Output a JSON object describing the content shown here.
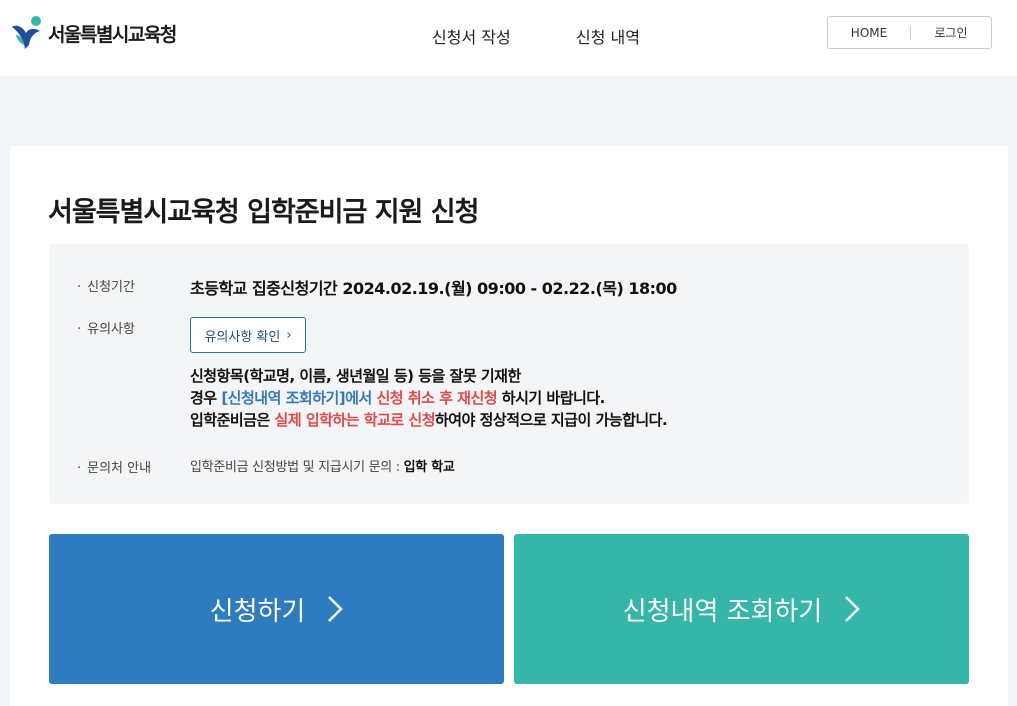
{
  "header": {
    "brand": "서울특별시교육청",
    "nav": [
      "신청서 작성",
      "신청 내역"
    ],
    "home_label": "HOME",
    "login_label": "로그인"
  },
  "page": {
    "title": "서울특별시교육청 입학준비금 지원 신청"
  },
  "info": {
    "period_label": "신청기간",
    "period_value": "초등학교 집중신청기간 2024.02.19.(월) 09:00 - 02.22.(목) 18:00",
    "notice_label": "유의사항",
    "notice_button": "유의사항 확인",
    "notice_line1": "신청항목(학교명, 이름, 생년월일 등) 등을 잘못 기재한",
    "notice_line2_a": "경우 ",
    "notice_line2_b": "[신청내역 조회하기]에서",
    "notice_line2_c": " ",
    "notice_line2_d": "신청 취소 후 재신청",
    "notice_line2_e": " 하시기 바랍니다.",
    "notice_line3_a": "입학준비금은 ",
    "notice_line3_b": "실제 입학하는 학교로 신청",
    "notice_line3_c": "하여야 정상적으로 지급이 가능합니다.",
    "contact_label": "문의처 안내",
    "contact_text": "입학준비금 신청방법 및 지급시기 문의 : ",
    "contact_value": "입학 학교"
  },
  "actions": {
    "apply_label": "신청하기",
    "query_label": "신청내역 조회하기"
  },
  "colors": {
    "apply_bg": "#2f7bbf",
    "query_bg": "#35b6a8",
    "accent_blue": "#3579b9",
    "accent_red": "#e04a4a"
  }
}
